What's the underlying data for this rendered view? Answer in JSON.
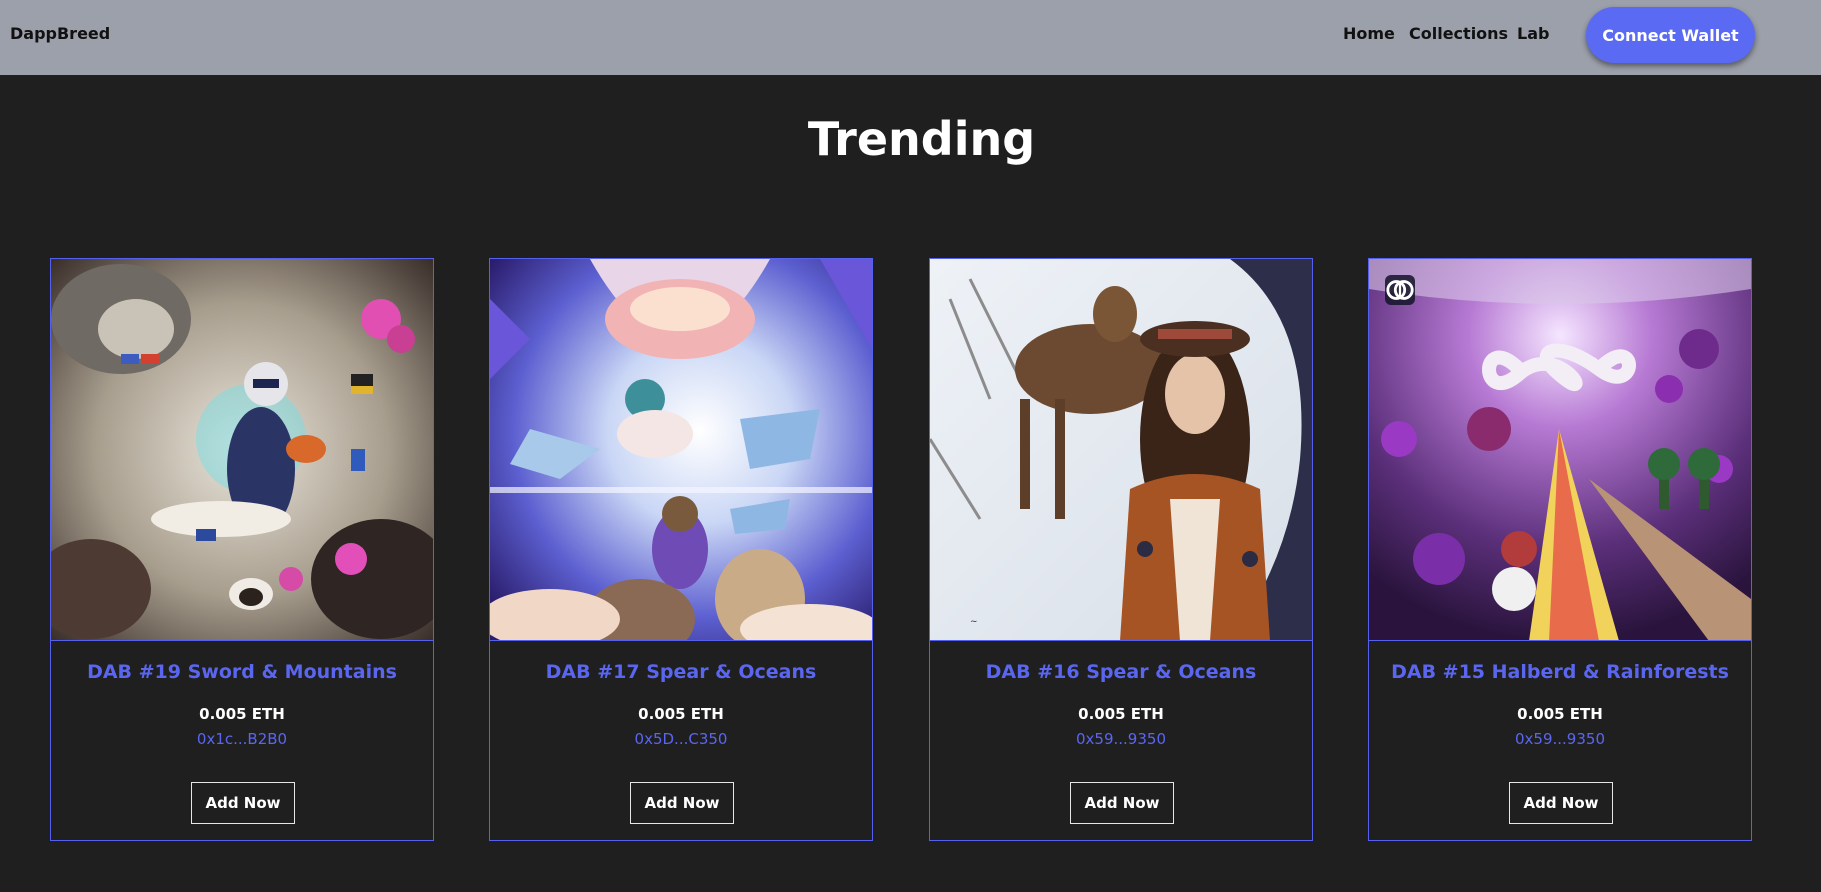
{
  "navbar": {
    "brand": "DappBreed",
    "links": [
      "Home",
      "Collections",
      "Lab"
    ],
    "connect_label": "Connect Wallet",
    "accent_color": "#5b6af2",
    "background_color": "#9ca0aa"
  },
  "page": {
    "title": "Trending",
    "background_color": "#1f1f1f"
  },
  "cards": [
    {
      "title": "DAB #19 Sword & Mountains",
      "price": "0.005 ETH",
      "owner": "0x1c...B2B0",
      "button_label": "Add Now",
      "image_subject": "astronaut-in-space-station"
    },
    {
      "title": "DAB #17 Spear & Oceans",
      "price": "0.005 ETH",
      "owner": "0x5D...C350",
      "button_label": "Add Now",
      "image_subject": "floating-islands-sky"
    },
    {
      "title": "DAB #16 Spear & Oceans",
      "price": "0.005 ETH",
      "owner": "0x59...9350",
      "button_label": "Add Now",
      "image_subject": "woman-with-deer"
    },
    {
      "title": "DAB #15 Halberd & Rainforests",
      "price": "0.005 ETH",
      "owner": "0x59...9350",
      "button_label": "Add Now",
      "image_subject": "infinity-rainbow-road",
      "badge_icon": "brain-icon"
    }
  ]
}
